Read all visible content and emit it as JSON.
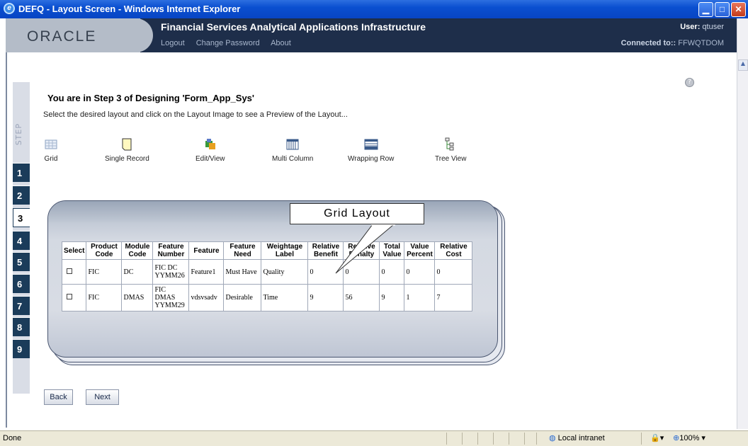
{
  "window": {
    "title": "DEFQ - Layout Screen - Windows Internet Explorer"
  },
  "header": {
    "logo": "ORACLE",
    "app_title": "Financial Services Analytical Applications Infrastructure",
    "links": [
      "Logout",
      "Change Password",
      "About"
    ],
    "user_label": "User:",
    "user_value": "qtuser",
    "connected_label": "Connected to::",
    "connected_value": "FFWQTDOM"
  },
  "steps": {
    "label": "STEP",
    "items": [
      "1",
      "2",
      "3",
      "4",
      "5",
      "6",
      "7",
      "8",
      "9"
    ],
    "active": "3"
  },
  "main": {
    "heading": "You are in Step 3 of Designing 'Form_App_Sys'",
    "instruction": "Select the desired layout and click on the Layout Image to see a Preview of the Layout...",
    "layouts": [
      {
        "label": "Grid",
        "icon": "grid-icon"
      },
      {
        "label": "Single Record",
        "icon": "single-record-icon"
      },
      {
        "label": "Edit/View",
        "icon": "edit-view-icon"
      },
      {
        "label": "Multi Column",
        "icon": "multi-column-icon"
      },
      {
        "label": "Wrapping Row",
        "icon": "wrapping-row-icon"
      },
      {
        "label": "Tree View",
        "icon": "tree-view-icon"
      }
    ],
    "preview_title": "Grid Layout",
    "table": {
      "headers": [
        "Select",
        "Product Code",
        "Module Code",
        "Feature Number",
        "Feature",
        "Feature Need",
        "Weightage Label",
        "Relative Benefit",
        "Relative Penalty",
        "Total Value",
        "Value Percent",
        "Relative Cost"
      ],
      "rows": [
        [
          "",
          "FIC",
          "DC",
          "FIC DC YYMM26",
          "Feature1",
          "Must Have",
          "Quality",
          "0",
          "0",
          "0",
          "0",
          "0"
        ],
        [
          "",
          "FIC",
          "DMAS",
          "FIC DMAS YYMM29",
          "vdsvsadv",
          "Desirable",
          "Time",
          "9",
          "56",
          "9",
          "1",
          "7"
        ]
      ]
    },
    "buttons": {
      "back": "Back",
      "next": "Next"
    }
  },
  "statusbar": {
    "status": "Done",
    "zone": "Local intranet",
    "zoom": "100%"
  },
  "colors": {
    "titlebar": "#0a4fd0",
    "header": "#1e2e4a",
    "step_active": "#ffffff",
    "step": "#1b3c5a"
  }
}
